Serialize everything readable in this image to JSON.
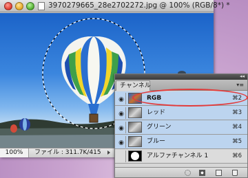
{
  "window": {
    "title": "3970279665_28e2702272.jpg @ 100% (RGB/8*) *"
  },
  "status": {
    "zoom": "100%",
    "file_info": "ファイル : 311.7K/415"
  },
  "panel": {
    "tab_label": "チャンネル",
    "collapse_glyph": "◂◂",
    "menu_glyph": "▾≡",
    "channels": [
      {
        "label": "RGB",
        "shortcut": "⌘2",
        "visible": true,
        "selected": true
      },
      {
        "label": "レッド",
        "shortcut": "⌘3",
        "visible": true,
        "selected": false
      },
      {
        "label": "グリーン",
        "shortcut": "⌘4",
        "visible": true,
        "selected": false
      },
      {
        "label": "ブルー",
        "shortcut": "⌘5",
        "visible": true,
        "selected": false
      },
      {
        "label": "アルファチャンネル 1",
        "shortcut": "⌘6",
        "visible": false,
        "selected": false
      }
    ],
    "eye_glyph": "◉"
  },
  "colors": {
    "highlight_oval": "#e23b3b",
    "row_selected": "#bcd4ef"
  }
}
